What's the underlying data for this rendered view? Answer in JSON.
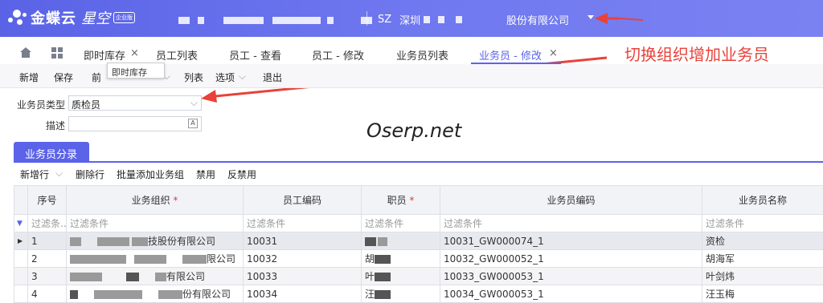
{
  "brand": {
    "name": "金蝶云",
    "product": "星空",
    "edition": "企业版"
  },
  "header": {
    "org_code": "SZ",
    "org_city": "深圳",
    "company_suffix": "股份有限公司"
  },
  "tabs": [
    {
      "label": "即时库存",
      "closable": true
    },
    {
      "label": "员工列表"
    },
    {
      "label": "员工 - 查看"
    },
    {
      "label": "员工 - 修改"
    },
    {
      "label": "业务员列表"
    },
    {
      "label": "业务员 - 修改",
      "active": true,
      "closable": true
    }
  ],
  "tooltip": "即时库存",
  "toolbar": {
    "new": "新增",
    "save": "保存",
    "prev": "前",
    "list": "列表",
    "options": "选项",
    "exit": "退出"
  },
  "form": {
    "type_label": "业务员类型",
    "type_value": "质检员",
    "desc_label": "描述",
    "desc_value": ""
  },
  "annotation": "切换组织增加业务员",
  "watermark": "Oserp.net",
  "section": {
    "tab_label": "业务员分录"
  },
  "grid_toolbar": {
    "add_row": "新增行",
    "delete_row": "删除行",
    "batch_add": "批量添加业务组",
    "disable": "禁用",
    "enable": "反禁用"
  },
  "table": {
    "headers": [
      "序号",
      "业务组织",
      "员工编码",
      "职员",
      "业务员编码",
      "业务员名称"
    ],
    "filter_placeholder": "过滤条...",
    "filter_text": "过滤条件",
    "rows": [
      {
        "seq": "1",
        "org": "技股份有限公司",
        "emp_code": "10031",
        "staff": "",
        "sales_code": "10031_GW000074_1",
        "name": "资检"
      },
      {
        "seq": "2",
        "org": "限公司",
        "emp_code": "10032",
        "staff": "胡",
        "sales_code": "10032_GW000052_1",
        "name": "胡海军"
      },
      {
        "seq": "3",
        "org": "有限公司",
        "emp_code": "10033",
        "staff": "叶",
        "sales_code": "10033_GW000053_1",
        "name": "叶剑炜"
      },
      {
        "seq": "4",
        "org": "份有限公司",
        "emp_code": "10034",
        "staff": "汪",
        "sales_code": "10034_GW000053_1",
        "name": "汪玉梅"
      }
    ]
  },
  "colors": {
    "accent": "#5b63e8",
    "annotation": "#e8423a"
  }
}
